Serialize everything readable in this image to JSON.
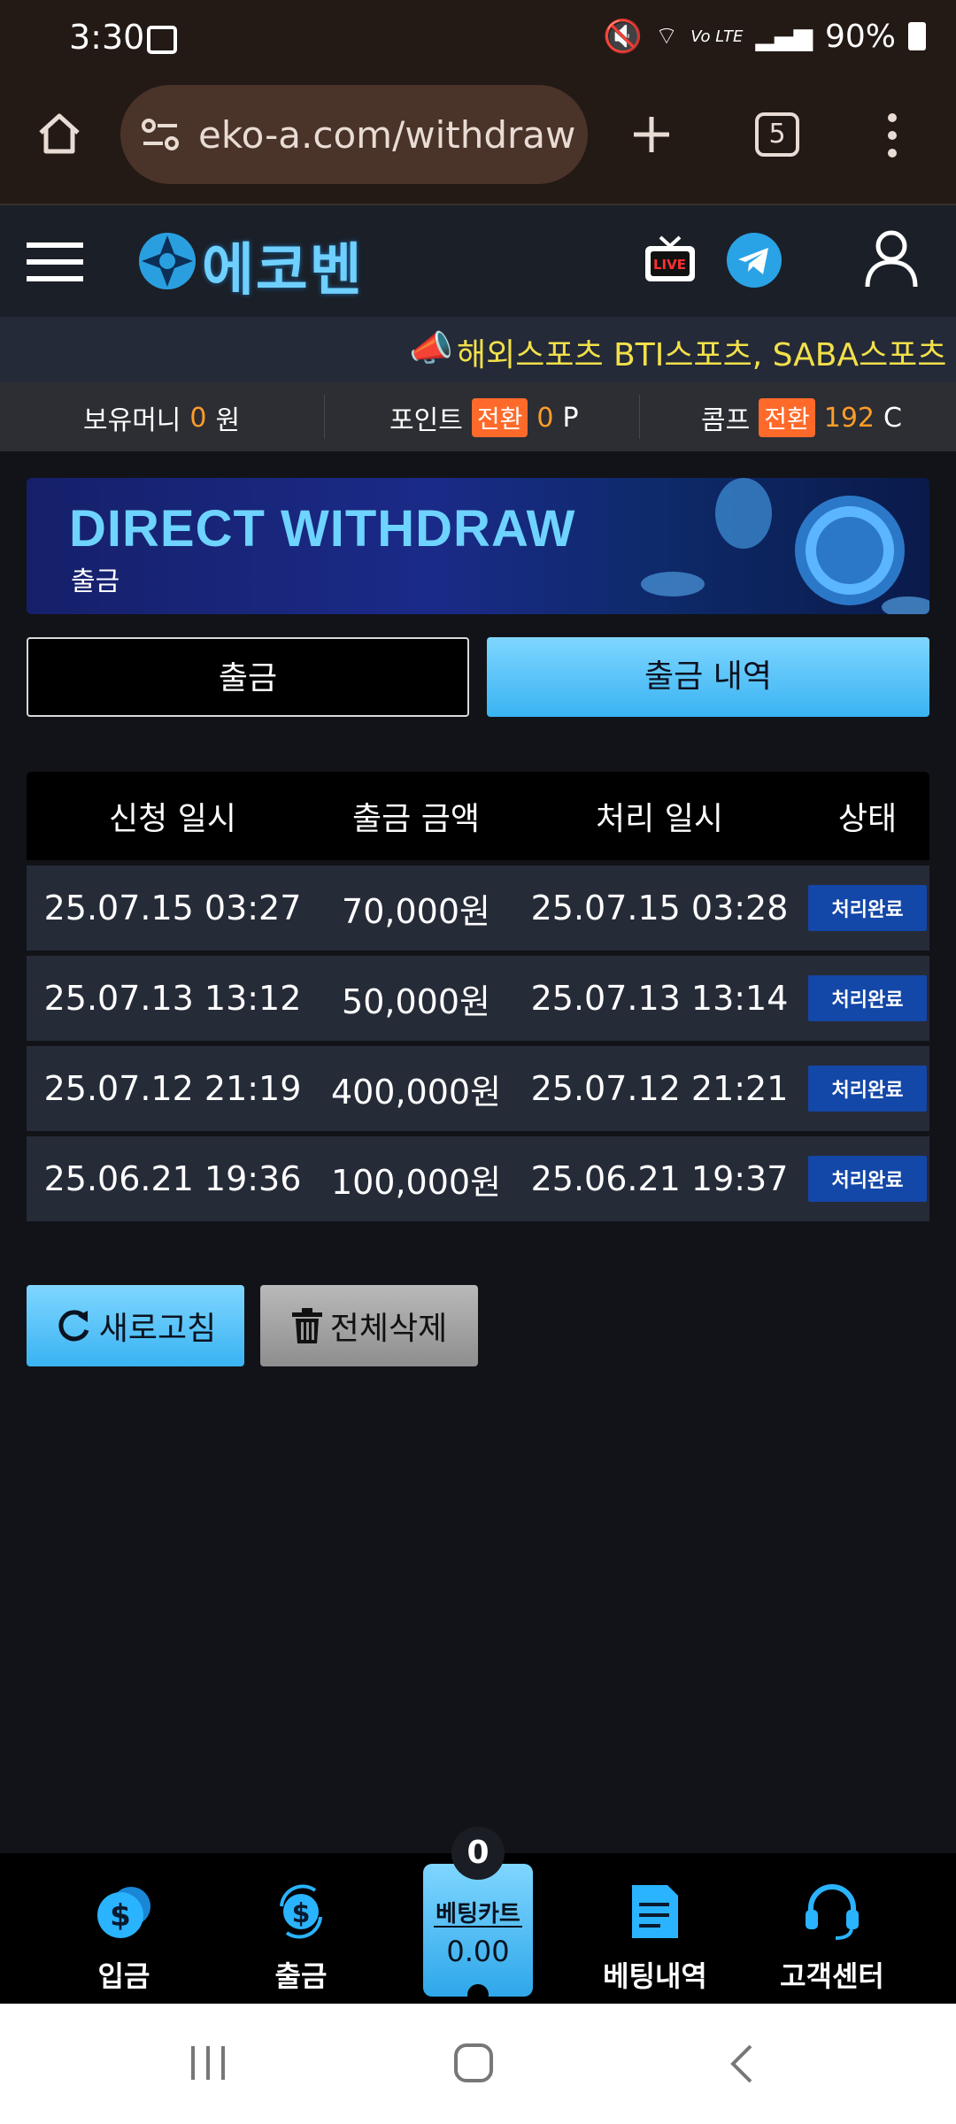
{
  "status_bar": {
    "time": "3:30",
    "battery": "90%",
    "network": "Vo LTE"
  },
  "browser": {
    "url": "eko-a.com/withdraw",
    "tab_count": "5"
  },
  "site": {
    "logo": "에코벤",
    "live_label": "LIVE"
  },
  "ticker": {
    "text": "해외스포츠 BTI스포츠, SABA스포츠 O"
  },
  "balances": {
    "money_label": "보유머니",
    "money_value": "0",
    "money_unit": "원",
    "point_label": "포인트",
    "point_convert": "전환",
    "point_value": "0",
    "point_unit": "P",
    "comp_label": "콤프",
    "comp_convert": "전환",
    "comp_value": "192",
    "comp_unit": "C"
  },
  "banner": {
    "title": "DIRECT WITHDRAW",
    "subtitle": "출금"
  },
  "tabs": {
    "withdraw": "출금",
    "history": "출금 내역"
  },
  "table": {
    "headers": [
      "신청 일시",
      "출금 금액",
      "처리 일시",
      "상태"
    ],
    "rows": [
      {
        "requested": "25.07.15 03:27",
        "amount": "70,000원",
        "processed": "25.07.15 03:28",
        "status": "처리완료"
      },
      {
        "requested": "25.07.13 13:12",
        "amount": "50,000원",
        "processed": "25.07.13 13:14",
        "status": "처리완료"
      },
      {
        "requested": "25.07.12 21:19",
        "amount": "400,000원",
        "processed": "25.07.12 21:21",
        "status": "처리완료"
      },
      {
        "requested": "25.06.21 19:36",
        "amount": "100,000원",
        "processed": "25.06.21 19:37",
        "status": "처리완료"
      }
    ]
  },
  "actions": {
    "refresh": "새로고침",
    "delete_all": "전체삭제"
  },
  "bottom_nav": {
    "deposit": "입금",
    "withdraw": "출금",
    "cart_label": "베팅카트",
    "cart_value": "0.00",
    "cart_count": "0",
    "bet_history": "베팅내역",
    "support": "고객센터"
  },
  "colors": {
    "accent": "#39b3f2",
    "status_badge": "#1347a8",
    "highlight": "#ff9c2a",
    "ticker_text": "#f2e04a"
  }
}
